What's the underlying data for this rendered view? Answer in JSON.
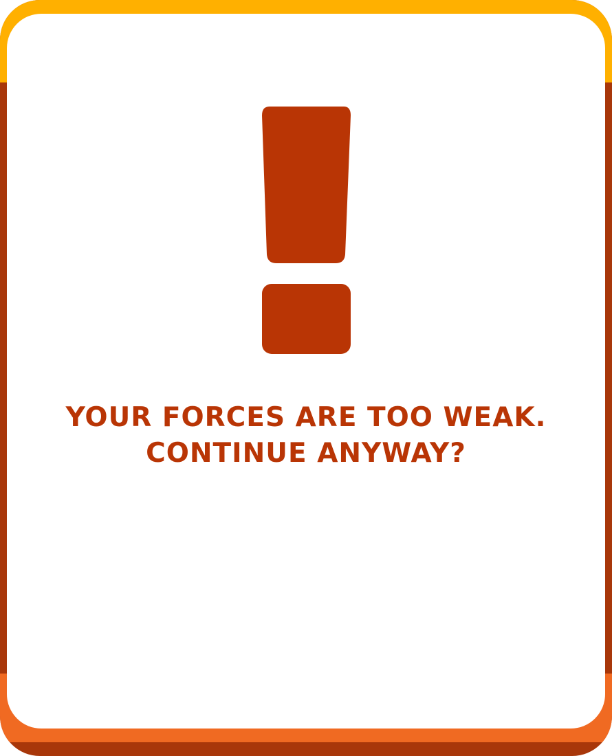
{
  "dialog": {
    "icon": "exclamation-icon",
    "message_line1": "YOUR FORCES ARE TOO WEAK.",
    "message_line2": "CONTINUE ANYWAY?"
  },
  "colors": {
    "frame_dark": "#a8370a",
    "frame_top": "#ffb000",
    "frame_bottom": "#f06a22",
    "panel": "#ffffff",
    "accent": "#b93505"
  }
}
